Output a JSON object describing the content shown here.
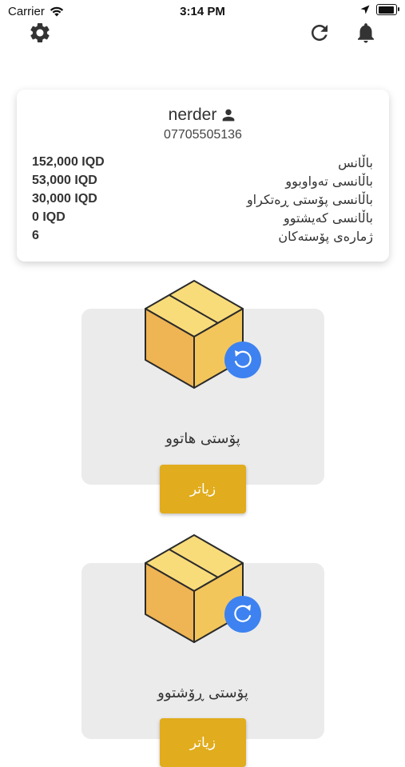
{
  "status_bar": {
    "carrier": "Carrier",
    "time": "3:14 PM"
  },
  "toolbar": {
    "settings_icon": "gear-icon",
    "refresh_icon": "refresh-icon",
    "notifications_icon": "bell-icon"
  },
  "account": {
    "username": "nerder",
    "phone": "07705505136",
    "stats": [
      {
        "label": "باڵانس",
        "value": "152,000 IQD"
      },
      {
        "label": "باڵانسی تەواوبوو",
        "value": "53,000 IQD"
      },
      {
        "label": "باڵانسی پۆستی ڕەتکراو",
        "value": "30,000 IQD"
      },
      {
        "label": "باڵانسی کەیشتوو",
        "value": "0 IQD"
      },
      {
        "label": "ژمارەی پۆستەکان",
        "value": "6"
      }
    ]
  },
  "tiles": [
    {
      "title": "پۆستی هاتوو",
      "button_label": "زیاتر",
      "badge_icon": "rotate-ccw-icon"
    },
    {
      "title": "پۆستی ڕۆشتوو",
      "button_label": "زیاتر",
      "badge_icon": "rotate-cw-icon"
    }
  ],
  "colors": {
    "accent": "#e1ac1d",
    "badge": "#3d82f0",
    "tile_bg": "#ebebeb"
  }
}
